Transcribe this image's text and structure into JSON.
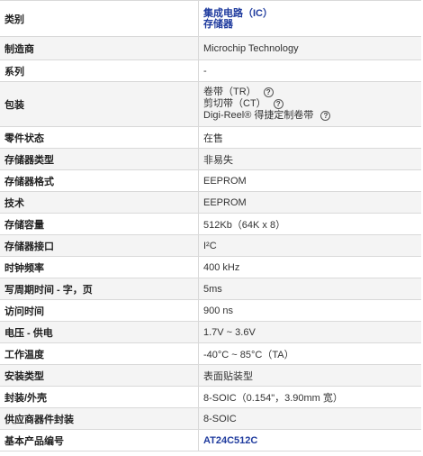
{
  "category": {
    "label": "类别",
    "values": [
      "集成电路（IC）",
      "存储器"
    ]
  },
  "rows": [
    {
      "label": "制造商",
      "value": "Microchip Technology"
    },
    {
      "label": "系列",
      "value": "-"
    },
    {
      "label": "零件状态",
      "value": "在售"
    },
    {
      "label": "存储器类型",
      "value": "非易失"
    },
    {
      "label": "存储器格式",
      "value": "EEPROM"
    },
    {
      "label": "技术",
      "value": "EEPROM"
    },
    {
      "label": "存储容量",
      "value": "512Kb（64K x 8）"
    },
    {
      "label": "存储器接口",
      "value": "I²C"
    },
    {
      "label": "时钟频率",
      "value": "400 kHz"
    },
    {
      "label": "写周期时间 - 字，页",
      "value": "5ms"
    },
    {
      "label": "访问时间",
      "value": "900 ns"
    },
    {
      "label": "电压 - 供电",
      "value": "1.7V ~ 3.6V"
    },
    {
      "label": "工作温度",
      "value": "-40°C ~ 85°C（TA）"
    },
    {
      "label": "安装类型",
      "value": "表面贴装型"
    },
    {
      "label": "封装/外壳",
      "value": "8-SOIC（0.154\"，3.90mm 宽）"
    },
    {
      "label": "供应商器件封装",
      "value": "8-SOIC"
    },
    {
      "label": "基本产品编号",
      "value": "AT24C512C"
    }
  ],
  "packaging": {
    "label": "包装",
    "options": [
      "卷带（TR）",
      "剪切带（CT）",
      "Digi-Reel® 得捷定制卷带"
    ],
    "help_glyph": "?"
  },
  "colors": {
    "link": "#1f3b9e",
    "alt_row": "#f4f4f4",
    "border": "#d9d9d9"
  },
  "icons": {
    "help": "question-circle-icon"
  }
}
